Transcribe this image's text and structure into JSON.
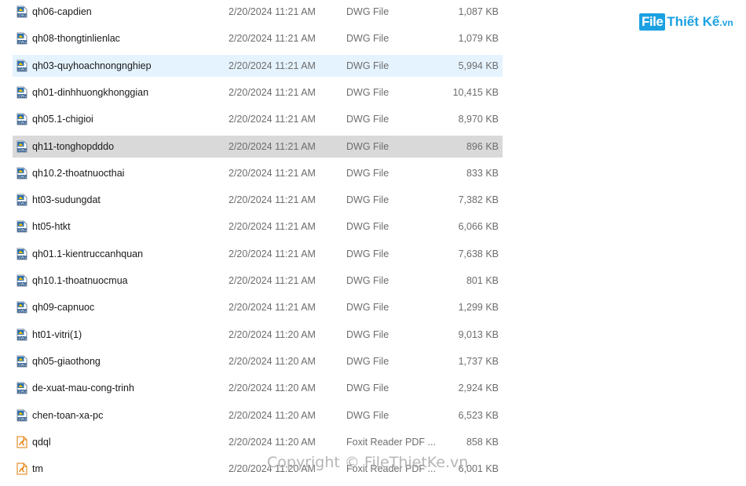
{
  "colors": {
    "selected_row_bg": "#d9d9d9",
    "hover_row_bg": "#e5f3ff",
    "logo_blue": "#1ba1e2"
  },
  "logo": {
    "prefix": "File",
    "rest": "Thiết Kế",
    "suffix": ".vn"
  },
  "watermark": "Copyright © FileThietKe.vn",
  "files": [
    {
      "name": "qh06-capdien",
      "date": "2/20/2024 11:21 AM",
      "type": "DWG File",
      "size": "1,087 KB",
      "icon": "dwg-file-icon",
      "state": ""
    },
    {
      "name": "qh08-thongtinlienlac",
      "date": "2/20/2024 11:21 AM",
      "type": "DWG File",
      "size": "1,079 KB",
      "icon": "dwg-file-icon",
      "state": ""
    },
    {
      "name": "qh03-quyhoachnongnghiep",
      "date": "2/20/2024 11:21 AM",
      "type": "DWG File",
      "size": "5,994 KB",
      "icon": "dwg-file-icon",
      "state": "hover"
    },
    {
      "name": "qh01-dinhhuongkhonggian",
      "date": "2/20/2024 11:21 AM",
      "type": "DWG File",
      "size": "10,415 KB",
      "icon": "dwg-file-icon",
      "state": ""
    },
    {
      "name": "qh05.1-chigioi",
      "date": "2/20/2024 11:21 AM",
      "type": "DWG File",
      "size": "8,970 KB",
      "icon": "dwg-file-icon",
      "state": ""
    },
    {
      "name": "qh11-tonghopdddo",
      "date": "2/20/2024 11:21 AM",
      "type": "DWG File",
      "size": "896 KB",
      "icon": "dwg-file-icon",
      "state": "selected"
    },
    {
      "name": "qh10.2-thoatnuocthai",
      "date": "2/20/2024 11:21 AM",
      "type": "DWG File",
      "size": "833 KB",
      "icon": "dwg-file-icon",
      "state": ""
    },
    {
      "name": "ht03-sudungdat",
      "date": "2/20/2024 11:21 AM",
      "type": "DWG File",
      "size": "7,382 KB",
      "icon": "dwg-file-icon",
      "state": ""
    },
    {
      "name": "ht05-htkt",
      "date": "2/20/2024 11:21 AM",
      "type": "DWG File",
      "size": "6,066 KB",
      "icon": "dwg-file-icon",
      "state": ""
    },
    {
      "name": "qh01.1-kientruccanhquan",
      "date": "2/20/2024 11:21 AM",
      "type": "DWG File",
      "size": "7,638 KB",
      "icon": "dwg-file-icon",
      "state": ""
    },
    {
      "name": "qh10.1-thoatnuocmua",
      "date": "2/20/2024 11:21 AM",
      "type": "DWG File",
      "size": "801 KB",
      "icon": "dwg-file-icon",
      "state": ""
    },
    {
      "name": "qh09-capnuoc",
      "date": "2/20/2024 11:21 AM",
      "type": "DWG File",
      "size": "1,299 KB",
      "icon": "dwg-file-icon",
      "state": ""
    },
    {
      "name": "ht01-vitri(1)",
      "date": "2/20/2024 11:20 AM",
      "type": "DWG File",
      "size": "9,013 KB",
      "icon": "dwg-file-icon",
      "state": ""
    },
    {
      "name": "qh05-giaothong",
      "date": "2/20/2024 11:20 AM",
      "type": "DWG File",
      "size": "1,737 KB",
      "icon": "dwg-file-icon",
      "state": ""
    },
    {
      "name": "de-xuat-mau-cong-trinh",
      "date": "2/20/2024 11:20 AM",
      "type": "DWG File",
      "size": "2,924 KB",
      "icon": "dwg-file-icon",
      "state": ""
    },
    {
      "name": "chen-toan-xa-pc",
      "date": "2/20/2024 11:20 AM",
      "type": "DWG File",
      "size": "6,523 KB",
      "icon": "dwg-file-icon",
      "state": ""
    },
    {
      "name": "qdql",
      "date": "2/20/2024 11:20 AM",
      "type": "Foxit Reader PDF ...",
      "size": "858 KB",
      "icon": "pdf-file-icon",
      "state": ""
    },
    {
      "name": "tm",
      "date": "2/20/2024 11:20 AM",
      "type": "Foxit Reader PDF ...",
      "size": "6,001 KB",
      "icon": "pdf-file-icon",
      "state": ""
    }
  ]
}
